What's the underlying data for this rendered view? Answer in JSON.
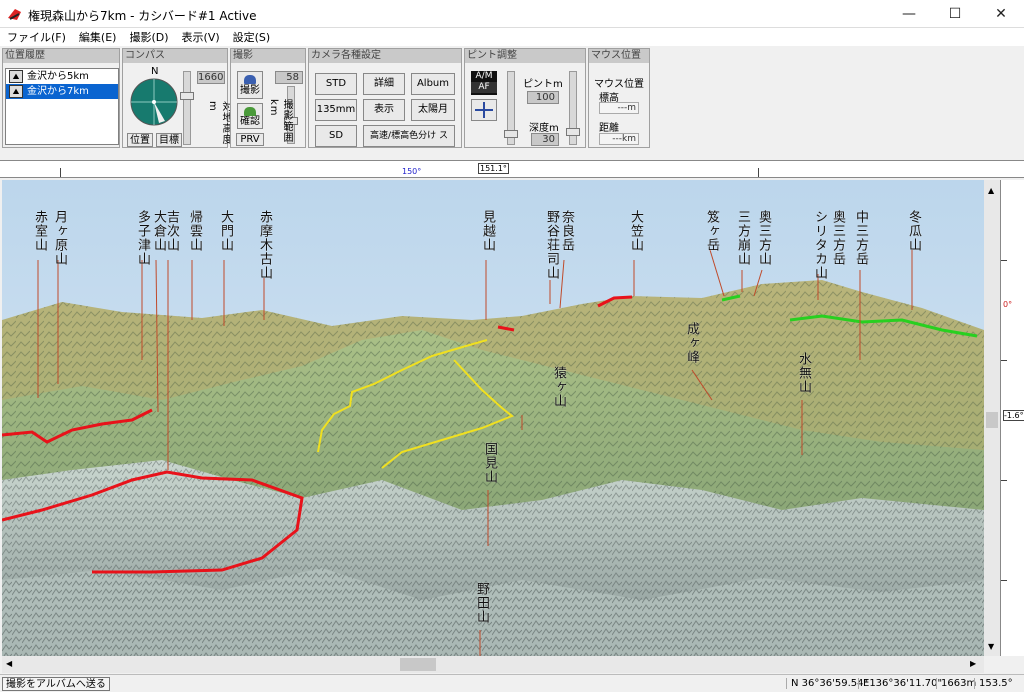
{
  "window": {
    "title": "権現森山から7km - カシバード#1 Active",
    "minimize_label": "—",
    "maximize_label": "☐",
    "close_label": "✕"
  },
  "menu": [
    "ファイル(F)",
    "編集(E)",
    "撮影(D)",
    "表示(V)",
    "設定(S)"
  ],
  "history": {
    "title": "位置履歴",
    "items": [
      {
        "label": "金沢から5km",
        "selected": false
      },
      {
        "label": "金沢から7km",
        "selected": true
      }
    ]
  },
  "compass": {
    "title": "コンパス",
    "north_label": "N",
    "elevation_value": "1660",
    "elevation_label": "対地高度m",
    "position_button": "位置",
    "target_button": "目標"
  },
  "shoot": {
    "title": "撮影",
    "shoot_button": "撮影",
    "confirm_button": "確認",
    "prv_button": "PRV",
    "range_value": "58",
    "range_label": "撮影範囲km"
  },
  "camera": {
    "title": "カメラ各種設定",
    "std_label": "STD",
    "detail_label": "詳細",
    "album_label": "Album",
    "lens_label": "135mm",
    "display_label": "表示",
    "sun_label": "太陽月",
    "sd_label": "SD",
    "color_label": "高速/標高色分け ス"
  },
  "focus": {
    "title": "ピント調整",
    "am_label": "A/M",
    "af_label": "AF",
    "focus_label": "ピントm",
    "focus_value": "100",
    "depth_label": "深度m",
    "depth_value": "30"
  },
  "mouse": {
    "title": "マウス位置",
    "elev_label": "標高",
    "elev_value": "---m",
    "dist_label": "距離",
    "dist_value": "---km"
  },
  "ruler": {
    "center_label": "150°",
    "value_label": "151.1°"
  },
  "rightscale": {
    "top_label": "0°",
    "mid_label": "-1.6°"
  },
  "peaks": [
    "赤室山",
    "月ヶ原山",
    "多子津山",
    "大倉山",
    "吉次山",
    "帰雲山",
    "大門山",
    "赤摩木古山",
    "見越山",
    "奈良岳",
    "野谷荘司山",
    "大笠山",
    "笈ヶ岳",
    "三方崩山",
    "奥三方山",
    "奥三方岳",
    "シリタカ山",
    "中三方岳",
    "冬瓜山",
    "成ヶ峰",
    "水無山",
    "猿ヶ山",
    "国見山",
    "野田山"
  ],
  "status": {
    "album_button": "撮影をアルバムへ送る",
    "north": "N 36°36'59.54\"",
    "east": "E136°36'11.70\"",
    "elevation": "1663m",
    "angle": "153.5°"
  },
  "colors": {
    "track_red": "#e8121a",
    "track_yellow": "#f0e020",
    "track_green": "#28d020",
    "sky_top": "#bcd6ec",
    "sky_bottom": "#dde9f3",
    "selection": "#0a64d0"
  }
}
